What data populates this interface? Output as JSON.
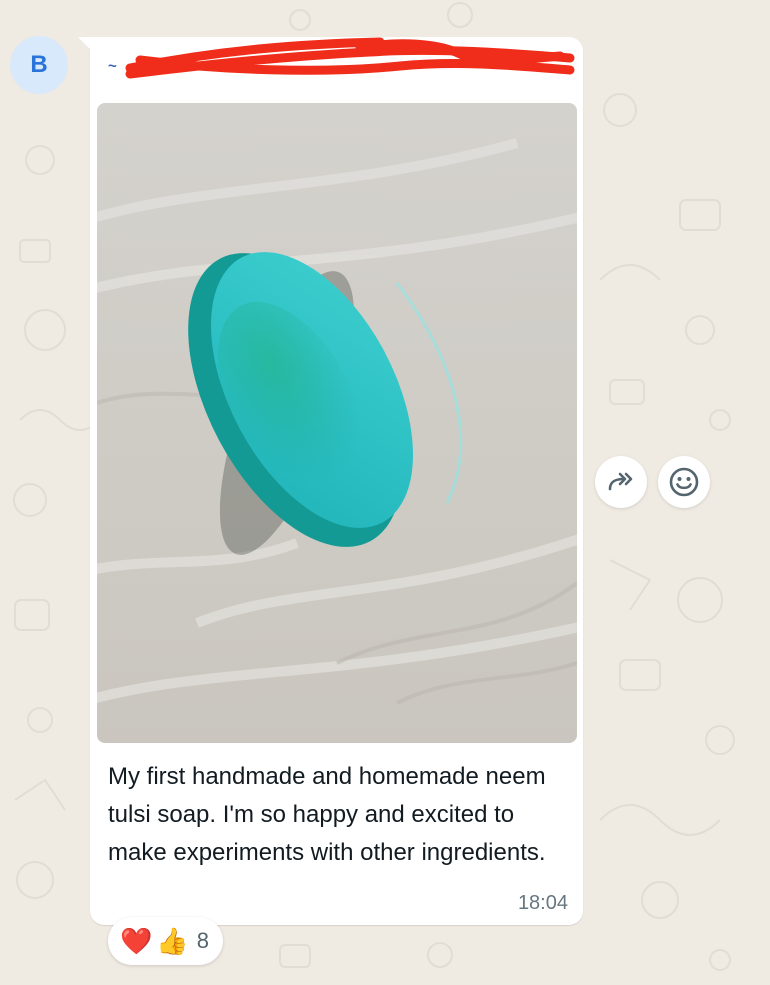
{
  "chat": {
    "avatar_initial": "B",
    "sender_name": "~",
    "message_caption": "My first handmade and homemade neem tulsi soap. I'm so happy and excited to make experiments with other ingredients.",
    "timestamp": "18:04"
  },
  "reactions": {
    "heart": "❤️",
    "thumbs_up": "👍",
    "count": "8"
  },
  "icons": {
    "forward": "forward-icon",
    "emoji": "smiley-icon"
  },
  "colors": {
    "background": "#efeae2",
    "bubble": "#ffffff",
    "sender_name": "#3a62b3",
    "redaction": "#f02d1a",
    "avatar_bg": "#d8e9fb",
    "avatar_text": "#2a73d9",
    "soap": "#2fc4c4"
  }
}
